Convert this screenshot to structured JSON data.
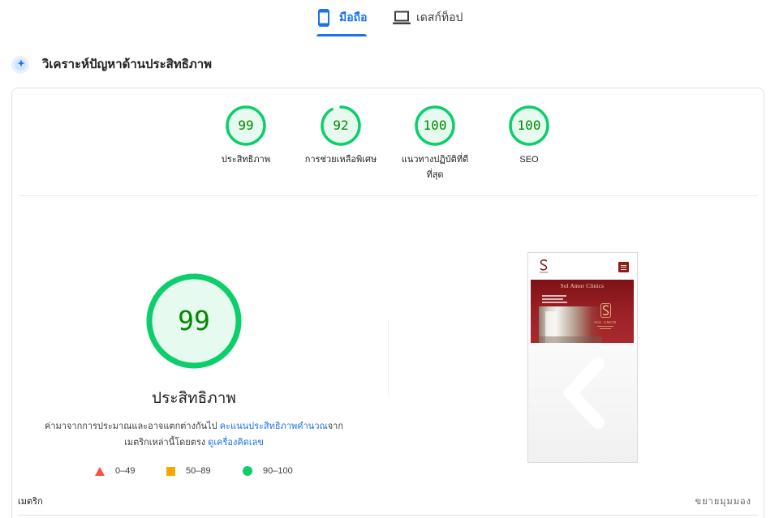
{
  "tabs": [
    {
      "label": "มือถือ",
      "icon": "phone-icon",
      "selected": true
    },
    {
      "label": "เดสก์ท็อป",
      "icon": "laptop-icon",
      "selected": false
    }
  ],
  "section": {
    "title": "วิเคราะห์ปัญหาด้านประสิทธิภาพ",
    "icon": "diagnose-icon"
  },
  "scores": [
    {
      "value": 99,
      "label": "ประสิทธิภาพ"
    },
    {
      "value": 92,
      "label": "การช่วยเหลือพิเศษ"
    },
    {
      "value": 100,
      "label": "แนวทางปฏิบัติที่ดีที่สุด"
    },
    {
      "value": 100,
      "label": "SEO"
    }
  ],
  "performance": {
    "score": 99,
    "title": "ประสิทธิภาพ",
    "desc_intro": "ค่ามาจากการประมาณและอาจแตกต่างกันไป ",
    "desc_link_score": "คะแนนประสิทธิภาพคำนวณ",
    "desc_after_link": "จาก",
    "desc_metrics": "เมตริกเหล่านี้โดยตรง ",
    "desc_link_calculator": "ดูเครื่องคิดเลข"
  },
  "legend": [
    {
      "range": "0–49",
      "icon": "fail-triangle-icon",
      "color": "#ff4e42"
    },
    {
      "range": "50–89",
      "icon": "average-square-icon",
      "color": "#ffa400"
    },
    {
      "range": "90–100",
      "icon": "pass-circle-icon",
      "color": "#0cce6b"
    }
  ],
  "preview": {
    "site_title": "Sol Amor Clinics",
    "logo_text": "SOL AMOR"
  },
  "metrics": {
    "label": "เมตริก",
    "expand_label": "ขยายมุมมอง"
  },
  "theme": {
    "accent": "#1a73e8",
    "pass": "#0cce6b",
    "pass_text": "#008800"
  }
}
